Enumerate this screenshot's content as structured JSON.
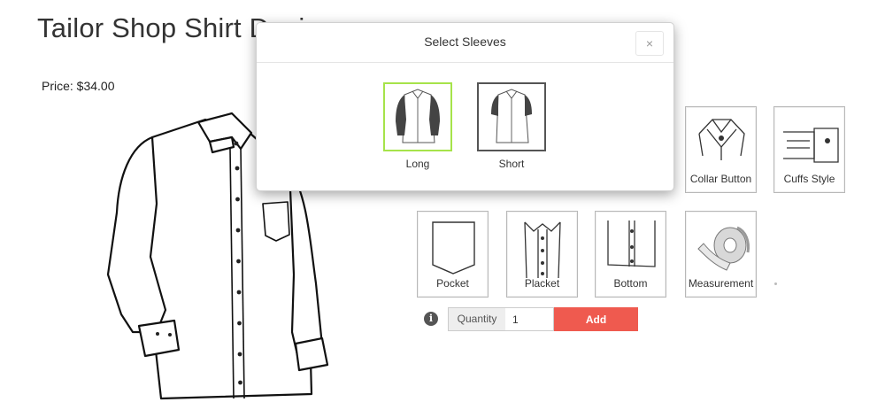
{
  "product": {
    "title": "Tailor Shop Shirt Desig",
    "price": "Price: $34.00"
  },
  "options_row1": [
    {
      "label": "Collar Button",
      "icon": "collar-button-icon"
    },
    {
      "label": "Cuffs Style",
      "icon": "cuffs-style-icon"
    }
  ],
  "options_row2": [
    {
      "label": "Pocket",
      "icon": "pocket-icon"
    },
    {
      "label": "Placket",
      "icon": "placket-icon"
    },
    {
      "label": "Bottom",
      "icon": "bottom-icon"
    },
    {
      "label": "Measurement",
      "icon": "measuring-tape-icon"
    }
  ],
  "cart": {
    "quantity_label": "Quantity",
    "quantity_value": "1",
    "add_label": "Add",
    "info_icon": "i"
  },
  "modal": {
    "title": "Select Sleeves",
    "close": "×",
    "options": [
      {
        "label": "Long",
        "selected": true
      },
      {
        "label": "Short",
        "selected": false
      }
    ]
  },
  "colors": {
    "accent_green": "#a6e34a",
    "add_button": "#ef5a4f"
  }
}
